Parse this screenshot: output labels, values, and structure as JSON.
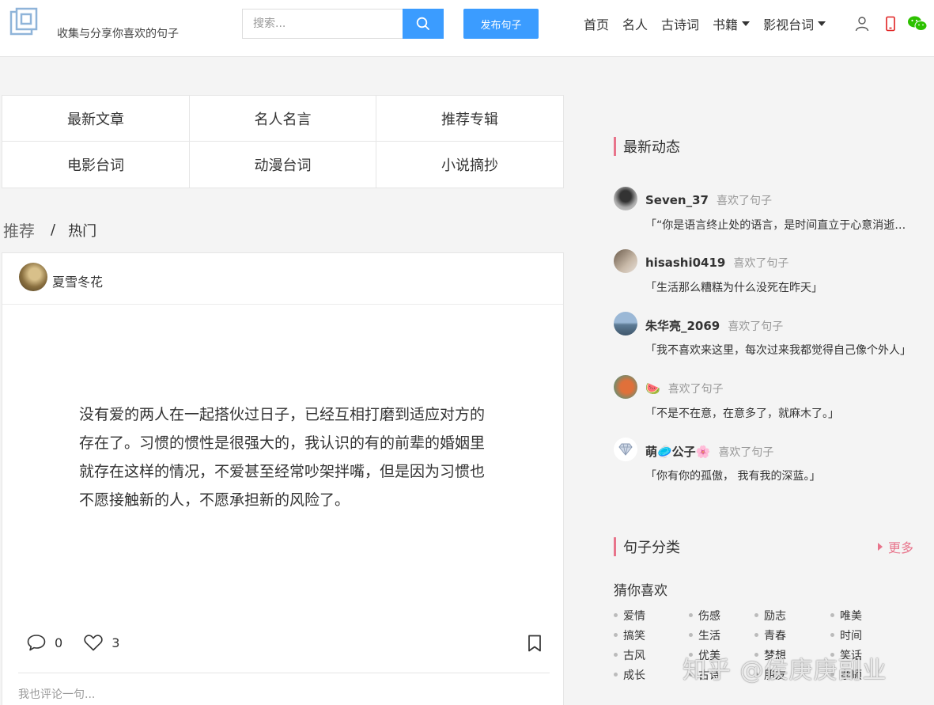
{
  "header": {
    "tagline": "收集与分享你喜欢的句子",
    "search_placeholder": "搜索...",
    "publish_label": "发布句子",
    "nav": [
      {
        "label": "首页"
      },
      {
        "label": "名人"
      },
      {
        "label": "古诗词"
      },
      {
        "label": "书籍"
      },
      {
        "label": "影视台词"
      }
    ],
    "colors": {
      "accent": "#3b9cff",
      "phone_icon": "#e02020",
      "wechat_icon": "#2dc100"
    }
  },
  "categories": [
    {
      "label": "最新文章"
    },
    {
      "label": "名人名言"
    },
    {
      "label": "推荐专辑"
    },
    {
      "label": "电影台词"
    },
    {
      "label": "动漫台词"
    },
    {
      "label": "小说摘抄"
    }
  ],
  "tabs": {
    "recommended": "推荐",
    "separator": "/",
    "hot": "热门"
  },
  "post": {
    "author": "夏雪冬花",
    "text": "没有爱的两人在一起搭伙过日子，已经互相打磨到适应对方的存在了。习惯的惯性是很强大的，我认识的有的前辈的婚姻里就存在这样的情况，不爱甚至经常吵架拌嘴，但是因为习惯也不愿接触新的人，不愿承担新的风险了。",
    "comment_count": "0",
    "like_count": "3",
    "comment_placeholder": "我也评论一句..."
  },
  "sidebar": {
    "activity_title": "最新动态",
    "activities": [
      {
        "user": "Seven_37",
        "action": "喜欢了句子",
        "quote": "「“你是语言终止处的语言，是时间直立于心意消逝的地方」"
      },
      {
        "user": "hisashi0419",
        "action": "喜欢了句子",
        "quote": "「生活那么糟糕为什么没死在昨天」"
      },
      {
        "user": "朱华亮_2069",
        "action": "喜欢了句子",
        "quote": "「我不喜欢来这里，每次过来我都觉得自己像个外人」"
      },
      {
        "user": "🍉",
        "action": "喜欢了句子",
        "quote": "「不是不在意，在意多了，就麻木了。」"
      },
      {
        "user": "萌🥏公子🌸",
        "action": "喜欢了句子",
        "quote": "「你有你的孤傲， 我有我的深蓝。」"
      }
    ],
    "category_title": "句子分类",
    "more_label": "更多",
    "guess_title": "猜你喜欢",
    "tags": [
      "爱情",
      "伤感",
      "励志",
      "唯美",
      "搞笑",
      "生活",
      "青春",
      "时间",
      "古风",
      "优美",
      "梦想",
      "笑话",
      "成长",
      "古诗",
      "朋友",
      "孝顺"
    ],
    "accent": "#e8748b"
  },
  "watermark": "知乎 @侯庚庚副业"
}
